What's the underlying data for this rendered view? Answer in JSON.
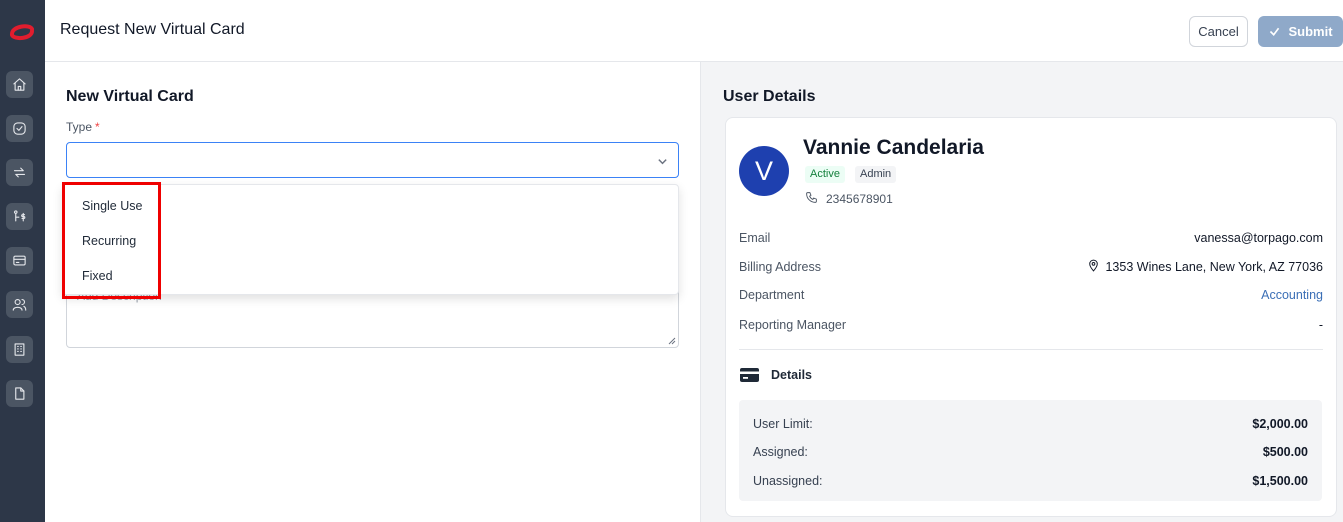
{
  "header": {
    "title": "Request New Virtual Card",
    "cancel_label": "Cancel",
    "submit_label": "Submit"
  },
  "sidebar": {
    "items": [
      {
        "icon": "home-icon"
      },
      {
        "icon": "check-circle-icon"
      },
      {
        "icon": "transfer-icon"
      },
      {
        "icon": "flow-dollar-icon"
      },
      {
        "icon": "credit-card-icon"
      },
      {
        "icon": "users-icon"
      },
      {
        "icon": "building-icon"
      },
      {
        "icon": "document-icon"
      }
    ]
  },
  "form": {
    "section_title": "New Virtual Card",
    "type_label": "Type",
    "required_mark": "*",
    "type_value": "",
    "dropdown_options": [
      "Single Use",
      "Recurring",
      "Fixed"
    ],
    "description_placeholder": "Add Description"
  },
  "user": {
    "section_title": "User Details",
    "avatar_letter": "V",
    "name": "Vannie Candelaria",
    "status": "Active",
    "role": "Admin",
    "phone": "2345678901",
    "email_label": "Email",
    "email": "vanessa@torpago.com",
    "billing_label": "Billing Address",
    "billing": "1353 Wines Lane, New York, AZ 77036",
    "department_label": "Department",
    "department": "Accounting",
    "manager_label": "Reporting Manager",
    "manager": "-",
    "details_title": "Details",
    "user_limit_label": "User Limit:",
    "user_limit": "$2,000.00",
    "assigned_label": "Assigned:",
    "assigned": "$500.00",
    "unassigned_label": "Unassigned:",
    "unassigned": "$1,500.00"
  },
  "colors": {
    "sidebar": "#2d3748",
    "accent": "#1e40af",
    "submit": "#8fa9c9",
    "highlight": "#ef0000",
    "link": "#3b6fb6"
  }
}
